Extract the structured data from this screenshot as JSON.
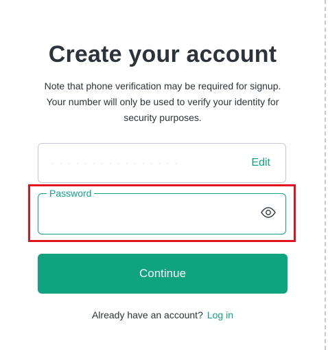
{
  "header": {
    "title": "Create your account",
    "note": "Note that phone verification may be required for signup. Your number will only be used to verify your identity for security purposes."
  },
  "email_field": {
    "value": "················",
    "edit_label": "Edit"
  },
  "password_field": {
    "label": "Password",
    "value": "",
    "placeholder": "",
    "toggle_icon": "eye-icon"
  },
  "continue_button": {
    "label": "Continue"
  },
  "login_prompt": {
    "text": "Already have an account?",
    "link_label": "Log in"
  },
  "colors": {
    "accent": "#10a37f",
    "highlight": "#e3121f",
    "text": "#2d333a",
    "border": "#c2c8d0"
  }
}
